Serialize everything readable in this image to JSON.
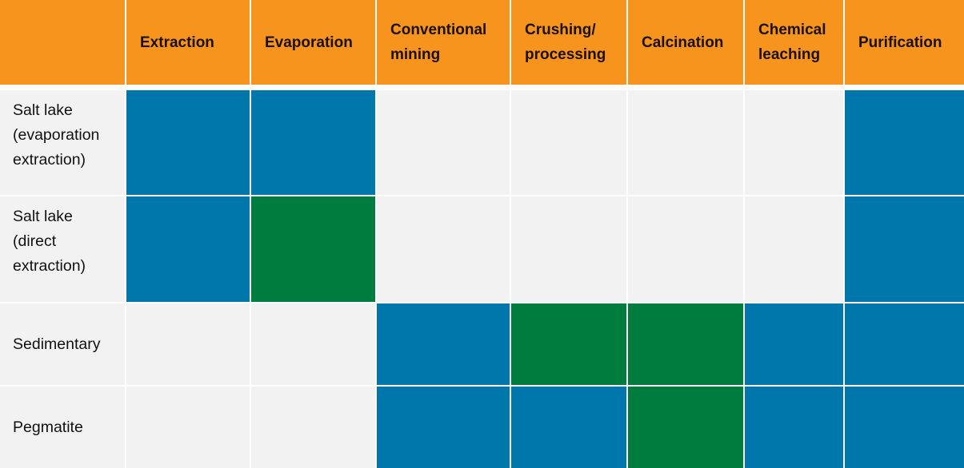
{
  "chart_data": {
    "type": "heatmap",
    "title": "",
    "columns": [
      "Extraction",
      "Evaporation",
      "Conventional mining",
      "Crushing/ processing",
      "Calcination",
      "Chemical leaching",
      "Purification"
    ],
    "rows": [
      "Salt lake (evaporation extraction)",
      "Salt lake (direct extraction)",
      "Sedimentary",
      "Pegmatite"
    ],
    "legend": {
      "blue": "blue",
      "green": "green",
      "none": "none"
    },
    "values": [
      [
        "blue",
        "blue",
        "none",
        "none",
        "none",
        "none",
        "blue"
      ],
      [
        "blue",
        "green",
        "none",
        "none",
        "none",
        "none",
        "blue"
      ],
      [
        "none",
        "none",
        "blue",
        "green",
        "green",
        "blue",
        "blue"
      ],
      [
        "none",
        "none",
        "blue",
        "blue",
        "green",
        "blue",
        "blue"
      ]
    ]
  },
  "header": {
    "corner": "",
    "columns": [
      {
        "line1": "Extraction",
        "line2": ""
      },
      {
        "line1": "Evaporation",
        "line2": ""
      },
      {
        "line1": "Conventional",
        "line2": "mining"
      },
      {
        "line1": "Crushing/",
        "line2": "processing"
      },
      {
        "line1": "Calcination",
        "line2": ""
      },
      {
        "line1": "Chemical",
        "line2": "leaching"
      },
      {
        "line1": "Purification",
        "line2": ""
      }
    ]
  },
  "row_labels": [
    {
      "lines": [
        "Salt lake",
        "(evaporation",
        "extraction)"
      ]
    },
    {
      "lines": [
        "Salt lake",
        "(direct",
        "extraction)"
      ]
    },
    {
      "lines": [
        "Sedimentary"
      ]
    },
    {
      "lines": [
        "Pegmatite"
      ]
    }
  ],
  "colors": {
    "header": "#F7941D",
    "blue": "#0077AA",
    "green": "#007D3E",
    "none": "#F2F2F2",
    "divider": "#FFFFFF"
  }
}
